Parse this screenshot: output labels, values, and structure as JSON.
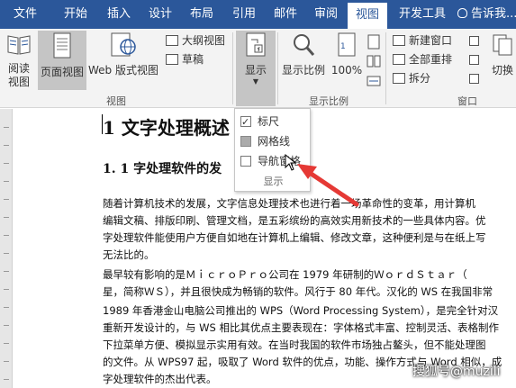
{
  "menu": {
    "tabs": [
      "文件",
      "开始",
      "插入",
      "设计",
      "布局",
      "引用",
      "邮件",
      "审阅",
      "视图",
      "开发工具"
    ],
    "active_tab": "视图",
    "tell_me": "告诉我..."
  },
  "ribbon": {
    "views_group": {
      "read_mode": "阅读\n视图",
      "read_mode_l1": "阅读",
      "read_mode_l2": "视图",
      "print_layout": "页面视图",
      "web_layout": "Web 版式视图",
      "outline": "大纲视图",
      "draft": "草稿",
      "label": "视图"
    },
    "show": {
      "label": "显示"
    },
    "zoom_group": {
      "zoom": "显示比例",
      "hundred": "100%",
      "label": "显示比例"
    },
    "window_group": {
      "new_window": "新建窗口",
      "arrange_all": "全部重排",
      "split": "拆分",
      "switch": "切换",
      "label": "窗口"
    }
  },
  "dropdown": {
    "items": [
      {
        "label": "标尺",
        "checked": true
      },
      {
        "label": "网格线",
        "checked": false
      },
      {
        "label": "导航窗格",
        "checked": false
      }
    ],
    "label": "显示"
  },
  "document": {
    "heading1": "1 文字处理概述",
    "heading2": "1. 1 字处理软件的发",
    "paragraphs": [
      "    随着计算机技术的发展，文字信息处理技术也进行着一场革命性的变革，用计算机",
      "编辑文稿、排版印刷、管理文档，是五彩缤纷的高效实用新技术的一些具体内容。优",
      "字处理软件能使用户方便自如地在计算机上编辑、修改文章，这种便利是与在纸上写",
      "无法比的。",
      "    最早较有影响的是ＭｉｃｒｏＰｒｏ公司在 1979 年研制的ＷｏｒｄＳｔａｒ（",
      "星，简称ＷＳ），并且很快成为畅销的软件。风行于 80 年代。汉化的 WS 在我国非常",
      "    1989 年香港金山电脑公司推出的 WPS（Word Processing System），是完全针对汉",
      "重新开发设计的，与 WS 相比其优点主要表现在：字体格式丰富、控制灵活、表格制作",
      "下拉菜单方便、模拟显示实用有效。在当时我国的软件市场独占鳌头，但不能处理图",
      "的文件。从 WPS97 起，吸取了 Word 软件的优点，功能、操作方式与 Word 相似，成",
      "字处理软件的杰出代表。"
    ]
  },
  "watermark": "搜狐号@muzili"
}
